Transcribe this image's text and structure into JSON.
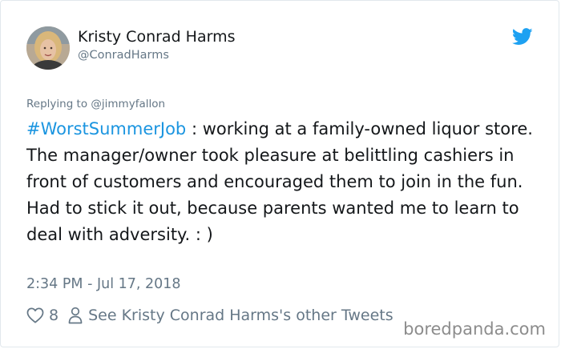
{
  "author": {
    "name": "Kristy Conrad Harms",
    "handle": "@ConradHarms"
  },
  "reply": {
    "text": "Replying to @jimmyfallon"
  },
  "tweet": {
    "hashtag": "#WorstSummerJob",
    "body": " : working at a family-owned liquor store. The manager/owner took pleasure at belittling cashiers in front of customers and encouraged them to join in the fun. Had to stick it out, because parents wanted me to learn to deal with adversity. : )",
    "timestamp": "2:34 PM - Jul 17, 2018"
  },
  "actions": {
    "like_count": "8",
    "other_tweets_label": "See Kristy Conrad Harms's other Tweets"
  },
  "watermark": {
    "text": "boredpanda.com"
  },
  "icons": {
    "brand": "twitter-bird-icon",
    "like": "heart-icon",
    "profile": "person-icon"
  },
  "colors": {
    "hashtag": "#1b95e0",
    "twitter_blue": "#1da1f2",
    "secondary_text": "#657786",
    "primary_text": "#14171a"
  }
}
